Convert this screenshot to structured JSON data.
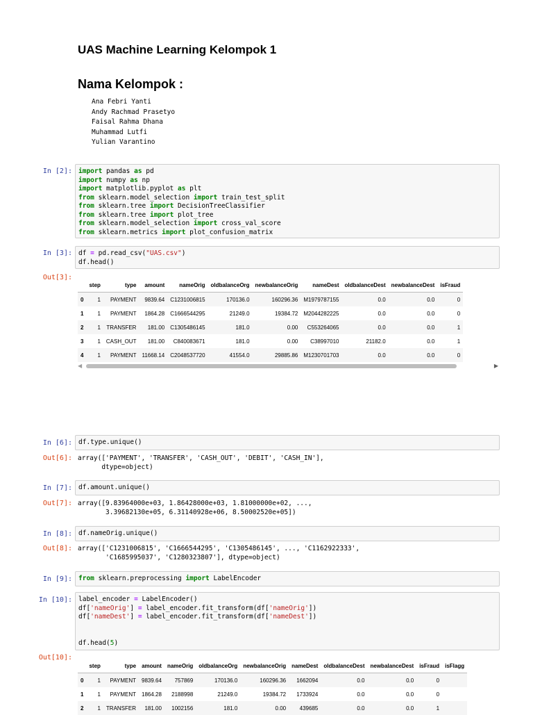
{
  "title": "UAS Machine Learning Kelompok 1",
  "subtitle": "Nama Kelompok :",
  "members": [
    "Ana Febri Yanti",
    "Andy Rachmad Prasetyo",
    "Faisal Rahma Dhana",
    "Muhammad Lutfi",
    "Yulian Varantino"
  ],
  "prompts": {
    "in2": "In [2]:",
    "in3": "In [3]:",
    "out3": "Out[3]:",
    "in6": "In [6]:",
    "out6": "Out[6]:",
    "in7": "In [7]:",
    "out7": "Out[7]:",
    "in8": "In [8]:",
    "out8": "Out[8]:",
    "in9": "In [9]:",
    "in10": "In [10]:",
    "out10": "Out[10]:"
  },
  "cells": {
    "c2": {
      "l1": [
        "import",
        " pandas ",
        "as",
        " pd"
      ],
      "l2": [
        "import",
        " numpy ",
        "as",
        " np"
      ],
      "l3": [
        "import",
        " matplotlib.pyplot ",
        "as",
        " plt"
      ],
      "l4": [
        "from",
        " sklearn.model_selection ",
        "import",
        " train_test_split"
      ],
      "l5": [
        "from",
        " sklearn.tree ",
        "import",
        " DecisionTreeClassifier"
      ],
      "l6": [
        "from",
        " sklearn.tree ",
        "import",
        " plot_tree"
      ],
      "l7": [
        "from",
        " sklearn.model_selection ",
        "import",
        " cross_val_score"
      ],
      "l8": [
        "from",
        " sklearn.metrics ",
        "import",
        " plot_confusion_matrix"
      ]
    },
    "c3": {
      "l1a": "df ",
      "l1eq": "=",
      "l1b": " pd.read_csv(",
      "l1s": "\"UAS.csv\"",
      "l1c": ")",
      "l2": "df.head()"
    },
    "c6": "df.type.unique()",
    "c7": "df.amount.unique()",
    "c8": "df.nameOrig.unique()",
    "c9": [
      "from",
      " sklearn.preprocessing ",
      "import",
      " LabelEncoder"
    ],
    "c10": {
      "l1a": "label_encoder ",
      "l1eq": "=",
      "l1b": " LabelEncoder()",
      "l2a": "df[",
      "l2s1": "'nameOrig'",
      "l2b": "] ",
      "l2eq": "=",
      "l2c": " label_encoder.fit_transform(df[",
      "l2s2": "'nameOrig'",
      "l2d": "])",
      "l3a": "df[",
      "l3s1": "'nameDest'",
      "l3b": "] ",
      "l3eq": "=",
      "l3c": " label_encoder.fit_transform(df[",
      "l3s2": "'nameDest'",
      "l3d": "])",
      "l4a": "df.head(",
      "l4n": "5",
      "l4b": ")"
    }
  },
  "outputs": {
    "o6": "array(['PAYMENT', 'TRANSFER', 'CASH_OUT', 'DEBIT', 'CASH_IN'],\n      dtype=object)",
    "o7": "array([9.83964000e+03, 1.86428000e+03, 1.81000000e+02, ...,\n       3.39682130e+05, 6.31140928e+06, 8.50002520e+05])",
    "o8": "array(['C1231006815', 'C1666544295', 'C1305486145', ..., 'C1162922333',\n       'C1685995037', 'C1280323807'], dtype=object)"
  },
  "table1": {
    "columns": [
      "",
      "step",
      "type",
      "amount",
      "nameOrig",
      "oldbalanceOrg",
      "newbalanceOrig",
      "nameDest",
      "oldbalanceDest",
      "newbalanceDest",
      "isFraud"
    ],
    "rows": [
      [
        "0",
        "1",
        "PAYMENT",
        "9839.64",
        "C1231006815",
        "170136.0",
        "160296.36",
        "M1979787155",
        "0.0",
        "0.0",
        "0"
      ],
      [
        "1",
        "1",
        "PAYMENT",
        "1864.28",
        "C1666544295",
        "21249.0",
        "19384.72",
        "M2044282225",
        "0.0",
        "0.0",
        "0"
      ],
      [
        "2",
        "1",
        "TRANSFER",
        "181.00",
        "C1305486145",
        "181.0",
        "0.00",
        "C553264065",
        "0.0",
        "0.0",
        "1"
      ],
      [
        "3",
        "1",
        "CASH_OUT",
        "181.00",
        "C840083671",
        "181.0",
        "0.00",
        "C38997010",
        "21182.0",
        "0.0",
        "1"
      ],
      [
        "4",
        "1",
        "PAYMENT",
        "11668.14",
        "C2048537720",
        "41554.0",
        "29885.86",
        "M1230701703",
        "0.0",
        "0.0",
        "0"
      ]
    ]
  },
  "table2": {
    "columns": [
      "",
      "step",
      "type",
      "amount",
      "nameOrig",
      "oldbalanceOrg",
      "newbalanceOrig",
      "nameDest",
      "oldbalanceDest",
      "newbalanceDest",
      "isFraud",
      "isFlagg"
    ],
    "rows": [
      [
        "0",
        "1",
        "PAYMENT",
        "9839.64",
        "757869",
        "170136.0",
        "160296.36",
        "1662094",
        "0.0",
        "0.0",
        "0",
        ""
      ],
      [
        "1",
        "1",
        "PAYMENT",
        "1864.28",
        "2188998",
        "21249.0",
        "19384.72",
        "1733924",
        "0.0",
        "0.0",
        "0",
        ""
      ],
      [
        "2",
        "1",
        "TRANSFER",
        "181.00",
        "1002156",
        "181.0",
        "0.00",
        "439685",
        "0.0",
        "0.0",
        "1",
        ""
      ]
    ]
  },
  "scrollbar": {
    "left_arrow": "◀",
    "right_arrow": "▶"
  }
}
